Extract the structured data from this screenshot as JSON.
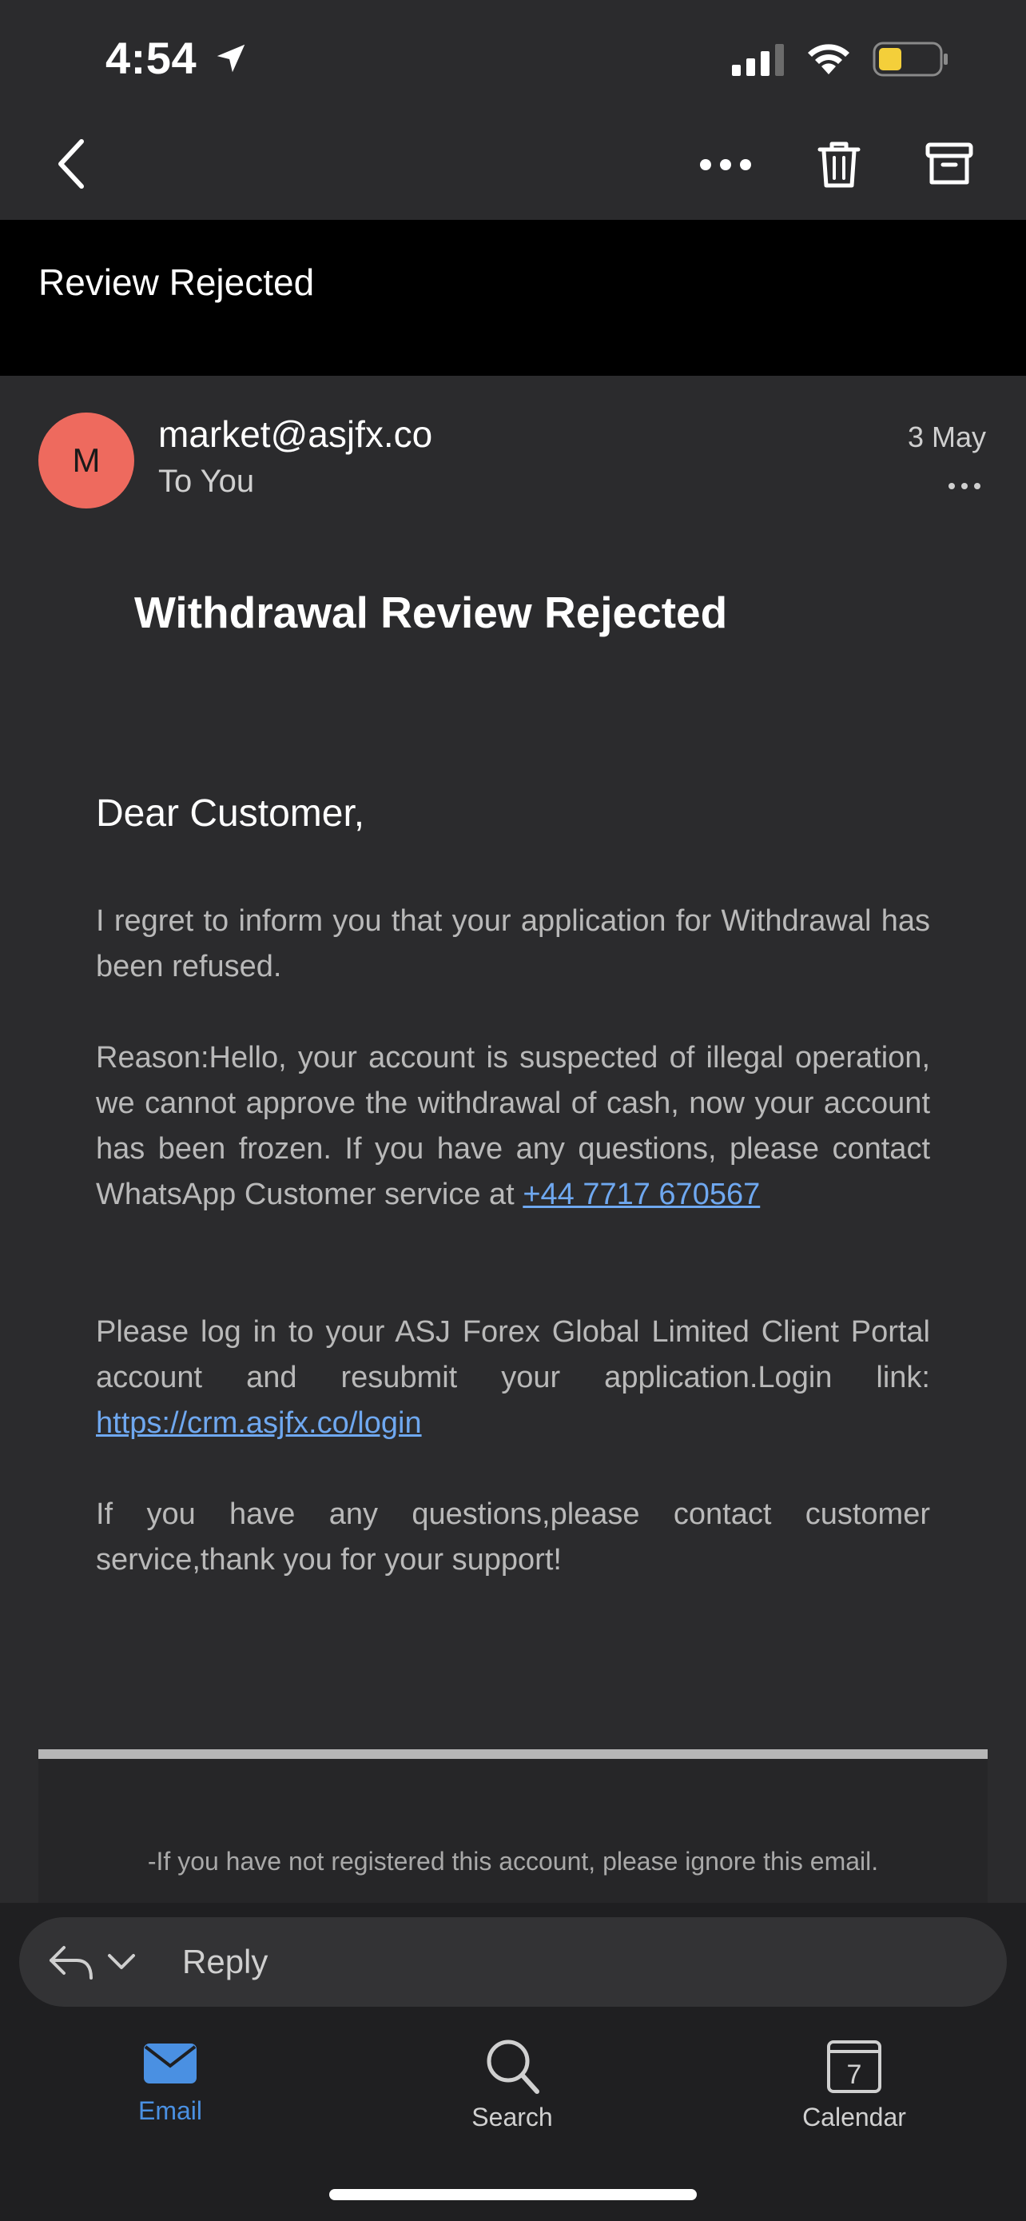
{
  "status_bar": {
    "time": "4:54",
    "icons": [
      "location-arrow-icon",
      "cellular-signal-icon",
      "wifi-icon",
      "battery-icon"
    ]
  },
  "toolbar": {
    "icons": [
      "chevron-left-icon",
      "ellipsis-icon",
      "trash-icon",
      "archive-icon"
    ]
  },
  "subject": "Review Rejected",
  "message": {
    "avatar_letter": "M",
    "sender": "market@asjfx.co",
    "recipient": "To You",
    "date": "3 May",
    "avatar_color": "#ee6a5e"
  },
  "body": {
    "title": "Withdrawal Review Rejected",
    "greeting": "Dear Customer,",
    "para1": "I regret to inform you that your application for Withdrawal has been refused.",
    "para2_text": "Reason:Hello, your account is suspected of illegal operation, we cannot approve the withdrawal of cash, now your account has been frozen. If you have any questions, please contact WhatsApp Customer service at ",
    "para2_link": "+44 7717 670567",
    "para3_text": "Please log in to your ASJ Forex Global Limited Client Portal account and resubmit your application.Login link: ",
    "para3_link": "https://crm.asjfx.co/login",
    "para4": "If you have any questions,please contact customer service,thank you for your support!",
    "footer_note": "-If you have not registered this account, please ignore this email.",
    "link_color": "#6fa8f0"
  },
  "reply": {
    "label": "Reply"
  },
  "tabs": [
    {
      "label": "Email",
      "icon": "mail-icon",
      "active": true
    },
    {
      "label": "Search",
      "icon": "search-icon",
      "active": false
    },
    {
      "label": "Calendar",
      "icon": "calendar-icon",
      "active": false,
      "day": "7"
    }
  ],
  "colors": {
    "accent": "#4a90e2",
    "background": "#2b2b2d"
  }
}
